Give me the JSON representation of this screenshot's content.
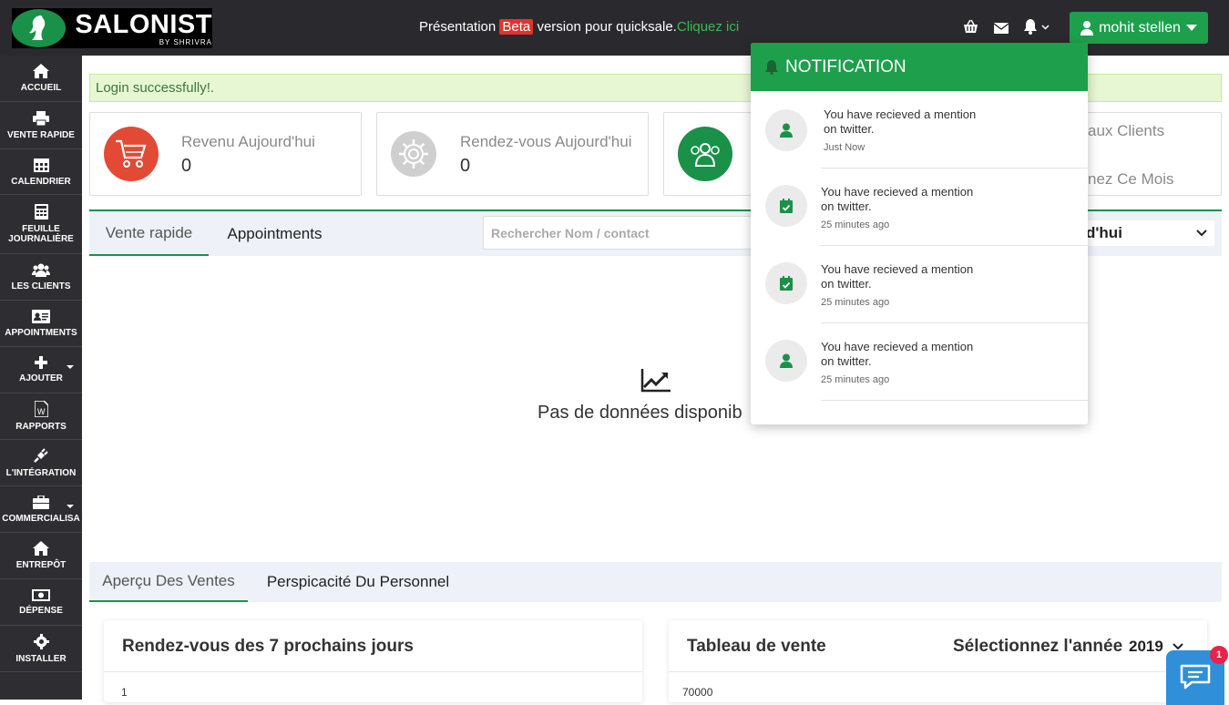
{
  "header": {
    "logo_name": "SALONIST",
    "logo_sub": "BY SHRIVRA",
    "promo_text": "Présentation",
    "promo_beta": "Beta",
    "promo_middle": "version pour quicksale.",
    "promo_link": "Cliquez ici",
    "user_name": "mohit stellen"
  },
  "sidebar": {
    "items": [
      {
        "label": "ACCUEIL",
        "icon": "home-icon"
      },
      {
        "label": "VENTE RAPIDE",
        "icon": "printer-icon"
      },
      {
        "label": "CALENDRIER",
        "icon": "calendar-icon"
      },
      {
        "label": "FEUILLE JOURNALIÈRE",
        "icon": "calculator-icon"
      },
      {
        "label": "LES CLIENTS",
        "icon": "users-icon"
      },
      {
        "label": "APPOINTMENTS",
        "icon": "id-card-icon"
      },
      {
        "label": "AJOUTER",
        "icon": "plus-icon"
      },
      {
        "label": "RAPPORTS",
        "icon": "word-file-icon"
      },
      {
        "label": "L'INTÉGRATION",
        "icon": "plug-icon"
      },
      {
        "label": "COMMERCIALISA",
        "icon": "briefcase-icon"
      },
      {
        "label": "ENTREPÔT",
        "icon": "warehouse-icon"
      },
      {
        "label": "DÉPENSE",
        "icon": "money-icon"
      },
      {
        "label": "INSTALLER",
        "icon": "cog-icon"
      }
    ]
  },
  "alert": {
    "text": "Login successfully!."
  },
  "cards": [
    {
      "title": "Revenu Aujourd'hui",
      "value": "0",
      "color": "#e34a35"
    },
    {
      "title": "Rendez-vous Aujourd'hui",
      "value": "0",
      "color": "#cfcfcf"
    },
    {
      "title": "aux Clients",
      "value": "",
      "color": "#1a9148"
    },
    {
      "title": "nez Ce Mois",
      "value": ""
    }
  ],
  "tabs": {
    "tab1": "Vente rapide",
    "tab2": "Appointments"
  },
  "search": {
    "placeholder": "Rechercher Nom / contact"
  },
  "period_select": {
    "value": "d'hui"
  },
  "empty": {
    "text": "Pas de données disponib"
  },
  "tabs2": {
    "tab1": "Aperçu Des Ventes",
    "tab2": "Perspicacité Du Personnel"
  },
  "panels": {
    "left_title": "Rendez-vous des 7 prochains jours",
    "left_tick": "1",
    "right_title": "Tableau de vente",
    "year_label": "Sélectionnez l'année",
    "year_value": "2019",
    "right_tick": "70000"
  },
  "notification": {
    "title": "NOTIFICATION",
    "items": [
      {
        "line1": "You have recieved a mention",
        "line2": "on twitter.",
        "time": "Just Now",
        "icon": "user-icon"
      },
      {
        "line1": "You have recieved a mention",
        "line2": "on twitter.",
        "time": "25 minutes ago",
        "icon": "calendar-check-icon"
      },
      {
        "line1": "You have recieved a mention",
        "line2": "on twitter.",
        "time": "25 minutes ago",
        "icon": "calendar-check-icon"
      },
      {
        "line1": "You have recieved a mention",
        "line2": "on twitter.",
        "time": "25 minutes ago",
        "icon": "user-icon"
      }
    ]
  },
  "chat": {
    "badge": "1"
  },
  "colors": {
    "brand_green": "#1e9f4c",
    "topbar": "#2a2a2e",
    "sidebar": "#2e2e32",
    "alert_bg": "#e7f7d4"
  }
}
